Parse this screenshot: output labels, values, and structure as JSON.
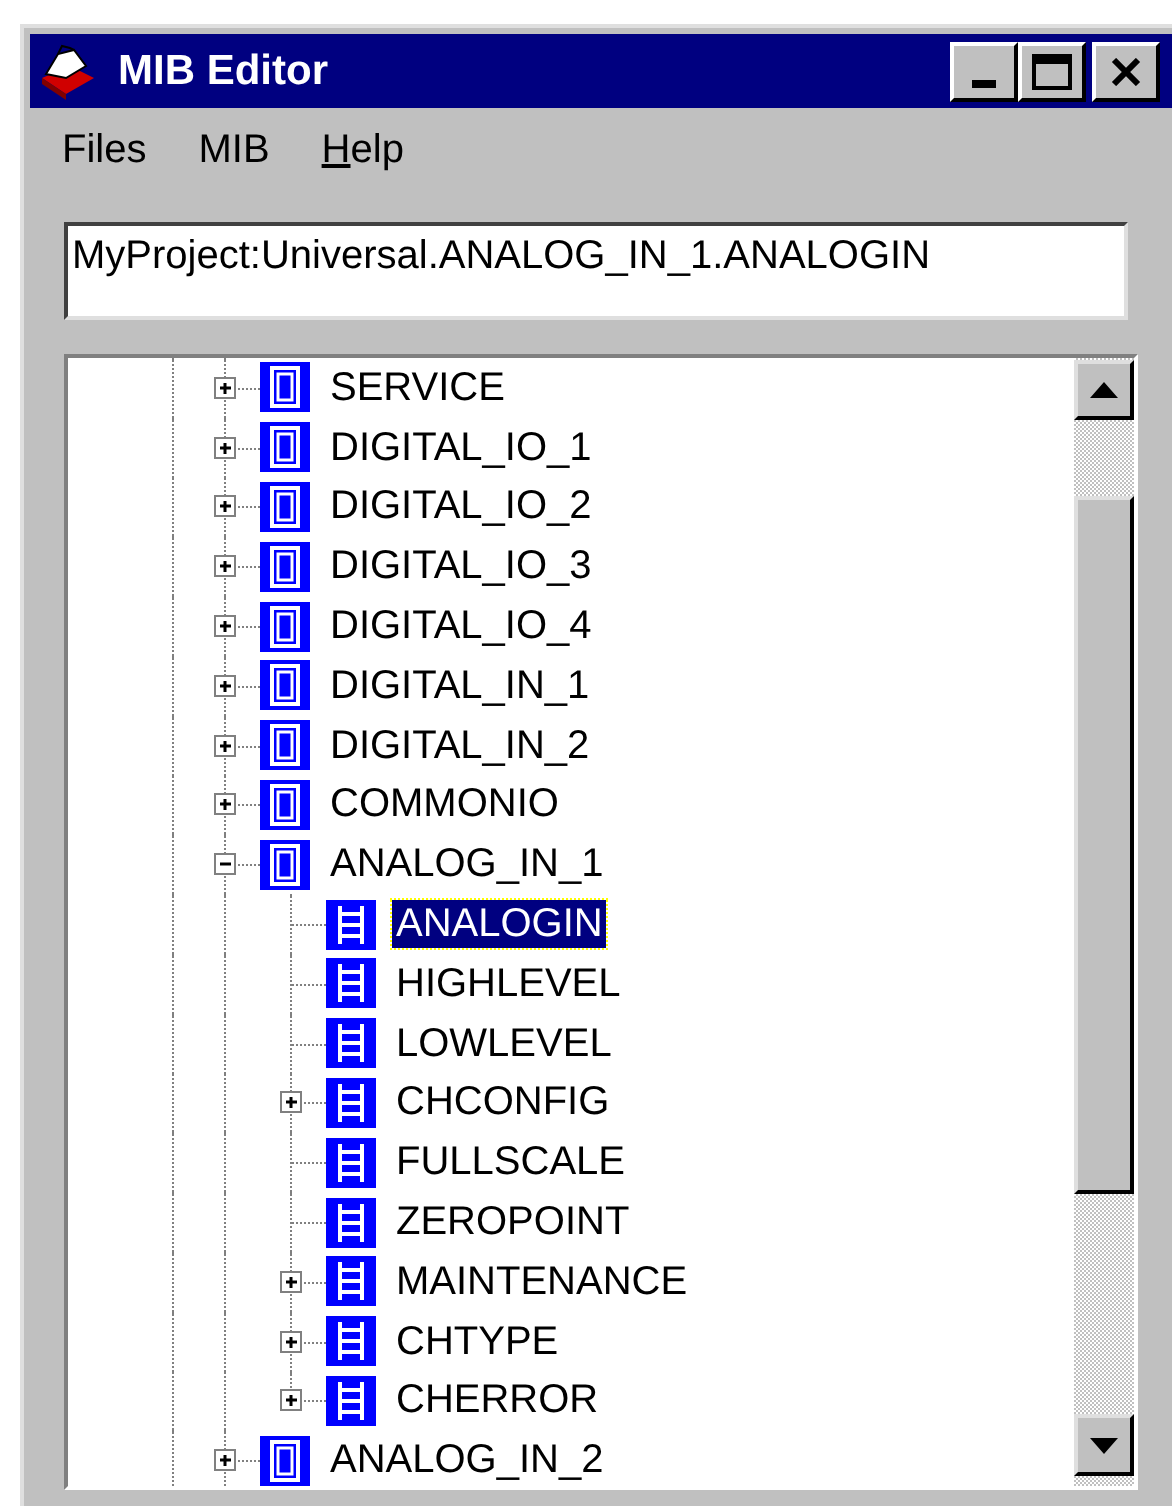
{
  "window": {
    "title": "MIB Editor"
  },
  "menu": [
    {
      "label": "Files",
      "mnemonic": false
    },
    {
      "label": "MIB",
      "mnemonic": false
    },
    {
      "label": "Help",
      "mnemonic": true
    }
  ],
  "path_field": {
    "value": "MyProject:Universal.ANALOG_IN_1.ANALOGIN"
  },
  "tree": [
    {
      "label": "SERVICE",
      "expanded": false,
      "selected": false
    },
    {
      "label": "DIGITAL_IO_1",
      "expanded": false,
      "selected": false
    },
    {
      "label": "DIGITAL_IO_2",
      "expanded": false,
      "selected": false
    },
    {
      "label": "DIGITAL_IO_3",
      "expanded": false,
      "selected": false
    },
    {
      "label": "DIGITAL_IO_4",
      "expanded": false,
      "selected": false
    },
    {
      "label": "DIGITAL_IN_1",
      "expanded": false,
      "selected": false
    },
    {
      "label": "DIGITAL_IN_2",
      "expanded": false,
      "selected": false
    },
    {
      "label": "COMMONIO",
      "expanded": false,
      "selected": false
    },
    {
      "label": "ANALOG_IN_1",
      "expanded": true,
      "selected": false,
      "children": [
        {
          "label": "ANALOGIN",
          "kind": "leaf",
          "selected": true
        },
        {
          "label": "HIGHLEVEL",
          "kind": "leaf",
          "selected": false
        },
        {
          "label": "LOWLEVEL",
          "kind": "leaf",
          "selected": false
        },
        {
          "label": "CHCONFIG",
          "kind": "branch",
          "expanded": false,
          "selected": false
        },
        {
          "label": "FULLSCALE",
          "kind": "leaf",
          "selected": false
        },
        {
          "label": "ZEROPOINT",
          "kind": "leaf",
          "selected": false
        },
        {
          "label": "MAINTENANCE",
          "kind": "branch",
          "expanded": false,
          "selected": false
        },
        {
          "label": "CHTYPE",
          "kind": "branch",
          "expanded": false,
          "selected": false
        },
        {
          "label": "CHERROR",
          "kind": "branch",
          "expanded": false,
          "selected": false
        }
      ]
    },
    {
      "label": "ANALOG_IN_2",
      "expanded": false,
      "selected": false
    }
  ]
}
